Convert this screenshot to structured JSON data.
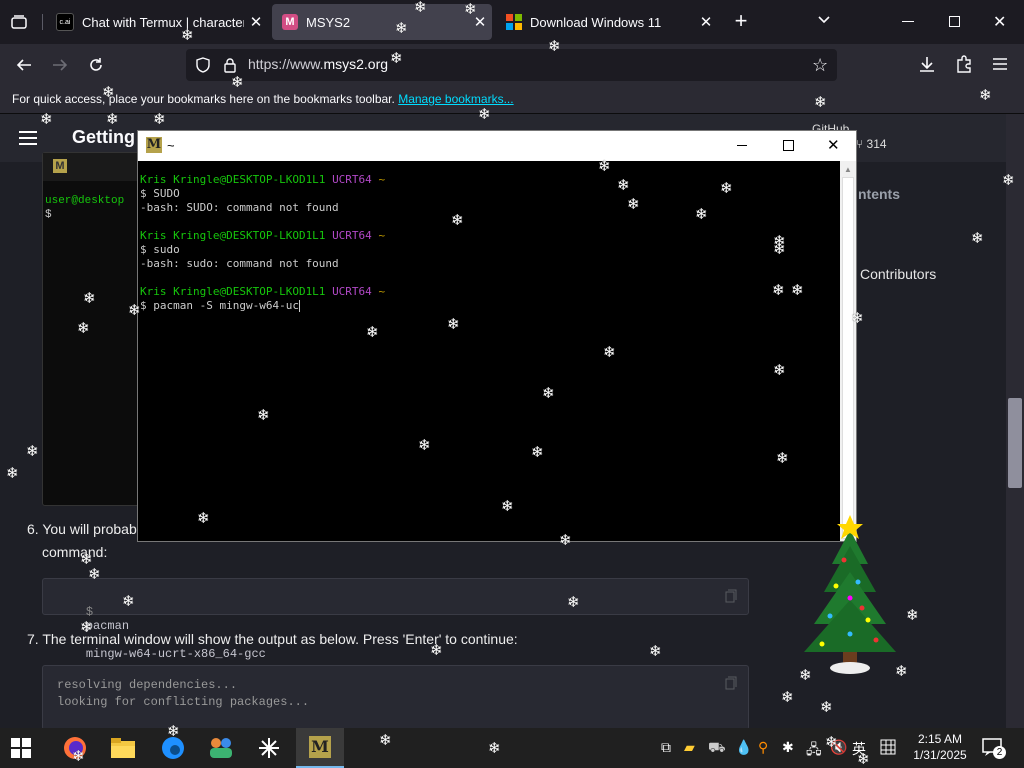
{
  "browser": {
    "tabs": [
      {
        "title": "Chat with Termux | character.ai",
        "favicon": "c.ai",
        "color": "#000000"
      },
      {
        "title": "MSYS2",
        "favicon": "M",
        "color": "#d24d84"
      },
      {
        "title": "Download Windows 11",
        "favicon": "windows-logo",
        "color": "#f25022"
      }
    ],
    "new_tab": "+",
    "url_prefix": "https://www.",
    "url_domain": "msys2.org",
    "bookmarks_text": "For quick access, place your bookmarks here on the bookmarks toolbar.",
    "bookmarks_link": "Manage bookmarks..."
  },
  "page": {
    "site_title": "Getting",
    "github_label": "GitHub",
    "github_stars": "314",
    "toc_partial": "ntents",
    "contributors": "Contributors",
    "inner_term_user": "user@desktop",
    "inner_term_prompt": "$",
    "step6_text": "6. You will probab",
    "step6_cont": "command:",
    "step6_code_prompt": "$",
    "step6_code_cmd": "pacman",
    "step6_code_arg": "mingw-w64-ucrt-x86_64-gcc",
    "step7_text": "7. The terminal window will show the output as below. Press 'Enter' to continue:",
    "output_line1": "resolving dependencies...",
    "output_line2": "looking for conflicting packages..."
  },
  "terminal": {
    "title": "~",
    "blocks": [
      {
        "user": "Kris Kringle@DESKTOP-LKOD1L1",
        "env": "UCRT64",
        "dir": "~",
        "cmd": "$ SUDO",
        "out": "-bash: SUDO: command not found"
      },
      {
        "user": "Kris Kringle@DESKTOP-LKOD1L1",
        "env": "UCRT64",
        "dir": "~",
        "cmd": "$ sudo",
        "out": "-bash: sudo: command not found"
      },
      {
        "user": "Kris Kringle@DESKTOP-LKOD1L1",
        "env": "UCRT64",
        "dir": "~",
        "cmd": "$ pacman -S mingw-w64-uc",
        "out": ""
      }
    ]
  },
  "taskbar": {
    "time": "2:15 AM",
    "date": "1/31/2025",
    "ime": "英",
    "notifications": "2"
  }
}
